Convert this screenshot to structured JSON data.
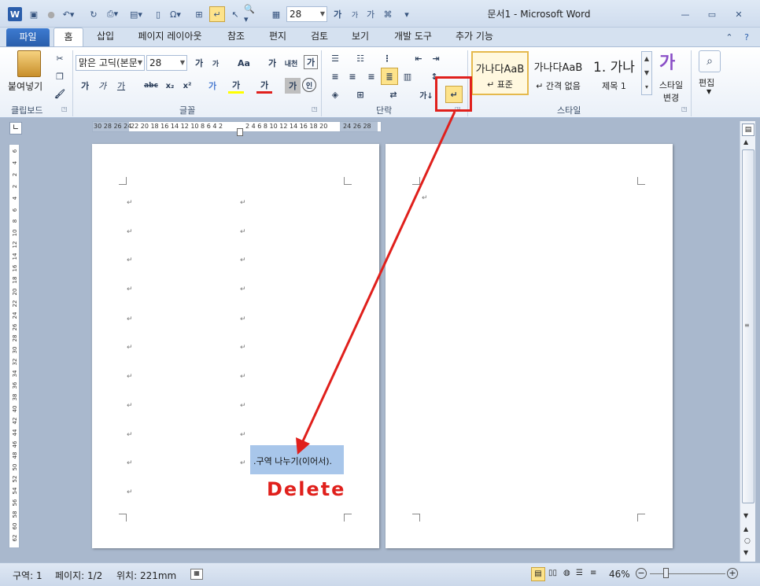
{
  "window": {
    "title": "문서1 - Microsoft Word"
  },
  "quick_access": {
    "font_size_value": "28",
    "grow_font": "가",
    "shrink_font": "가",
    "phonetic": "가"
  },
  "tabs": [
    {
      "label": "파일"
    },
    {
      "label": "홈"
    },
    {
      "label": "삽입"
    },
    {
      "label": "페이지 레이아웃"
    },
    {
      "label": "참조"
    },
    {
      "label": "편지"
    },
    {
      "label": "검토"
    },
    {
      "label": "보기"
    },
    {
      "label": "개발 도구"
    },
    {
      "label": "추가 기능"
    }
  ],
  "clipboard": {
    "paste_label": "붙여넣기",
    "group_label": "클립보드"
  },
  "font": {
    "name_value": "맑은 고딕(본문",
    "size_value": "28",
    "grow": "가",
    "shrink": "가",
    "case": "Aa",
    "phonetic": "가",
    "char_border": "내천",
    "bold": "가",
    "italic": "가",
    "underline": "가",
    "strike": "abc",
    "subscript": "x₂",
    "superscript": "x²",
    "text_effect": "가",
    "highlight": "가",
    "font_color": "가",
    "char_shade": "가",
    "enclose": "인",
    "group_label": "글꼴"
  },
  "paragraph": {
    "group_label": "단락",
    "sort": "가↓"
  },
  "styles": {
    "items": [
      {
        "preview": "가나다AaB",
        "name": "↵ 표준"
      },
      {
        "preview": "가나다AaB",
        "name": "↵ 간격 없음"
      },
      {
        "preview": "1.  가나",
        "name": "제목 1"
      }
    ],
    "change_label_1": "스타일",
    "change_label_2": "변경",
    "group_label": "스타일"
  },
  "editing": {
    "label": "편집"
  },
  "ruler": {
    "left_ticks": "30 28 26 24",
    "mid_ticks": "22 20 18 16 14 12 10 8 6 4 2",
    "right_ticks": "2 4 6 8 10 12 14 16 18 20",
    "far_ticks": "24 26 28",
    "vertical_ticks": [
      "6",
      "4",
      "2",
      "2",
      "4",
      "6",
      "8",
      "10",
      "12",
      "14",
      "16",
      "18",
      "20",
      "22",
      "24",
      "26",
      "28",
      "30",
      "32",
      "34",
      "36",
      "38",
      "40",
      "42",
      "44",
      "46",
      "48",
      "50",
      "52",
      "54",
      "56",
      "58",
      "60",
      "62"
    ]
  },
  "document": {
    "para_mark": "↵",
    "section_break_text": "구역 나누기(이어서)",
    "annotation_delete": "Delete"
  },
  "status": {
    "section": "구역: 1",
    "page": "페이지: 1/2",
    "position": "위치: 221mm",
    "zoom": "46%"
  },
  "colors": {
    "accent": "#e0201c",
    "selection": "#a8c6ea",
    "highlight_button": "#fde38b"
  }
}
